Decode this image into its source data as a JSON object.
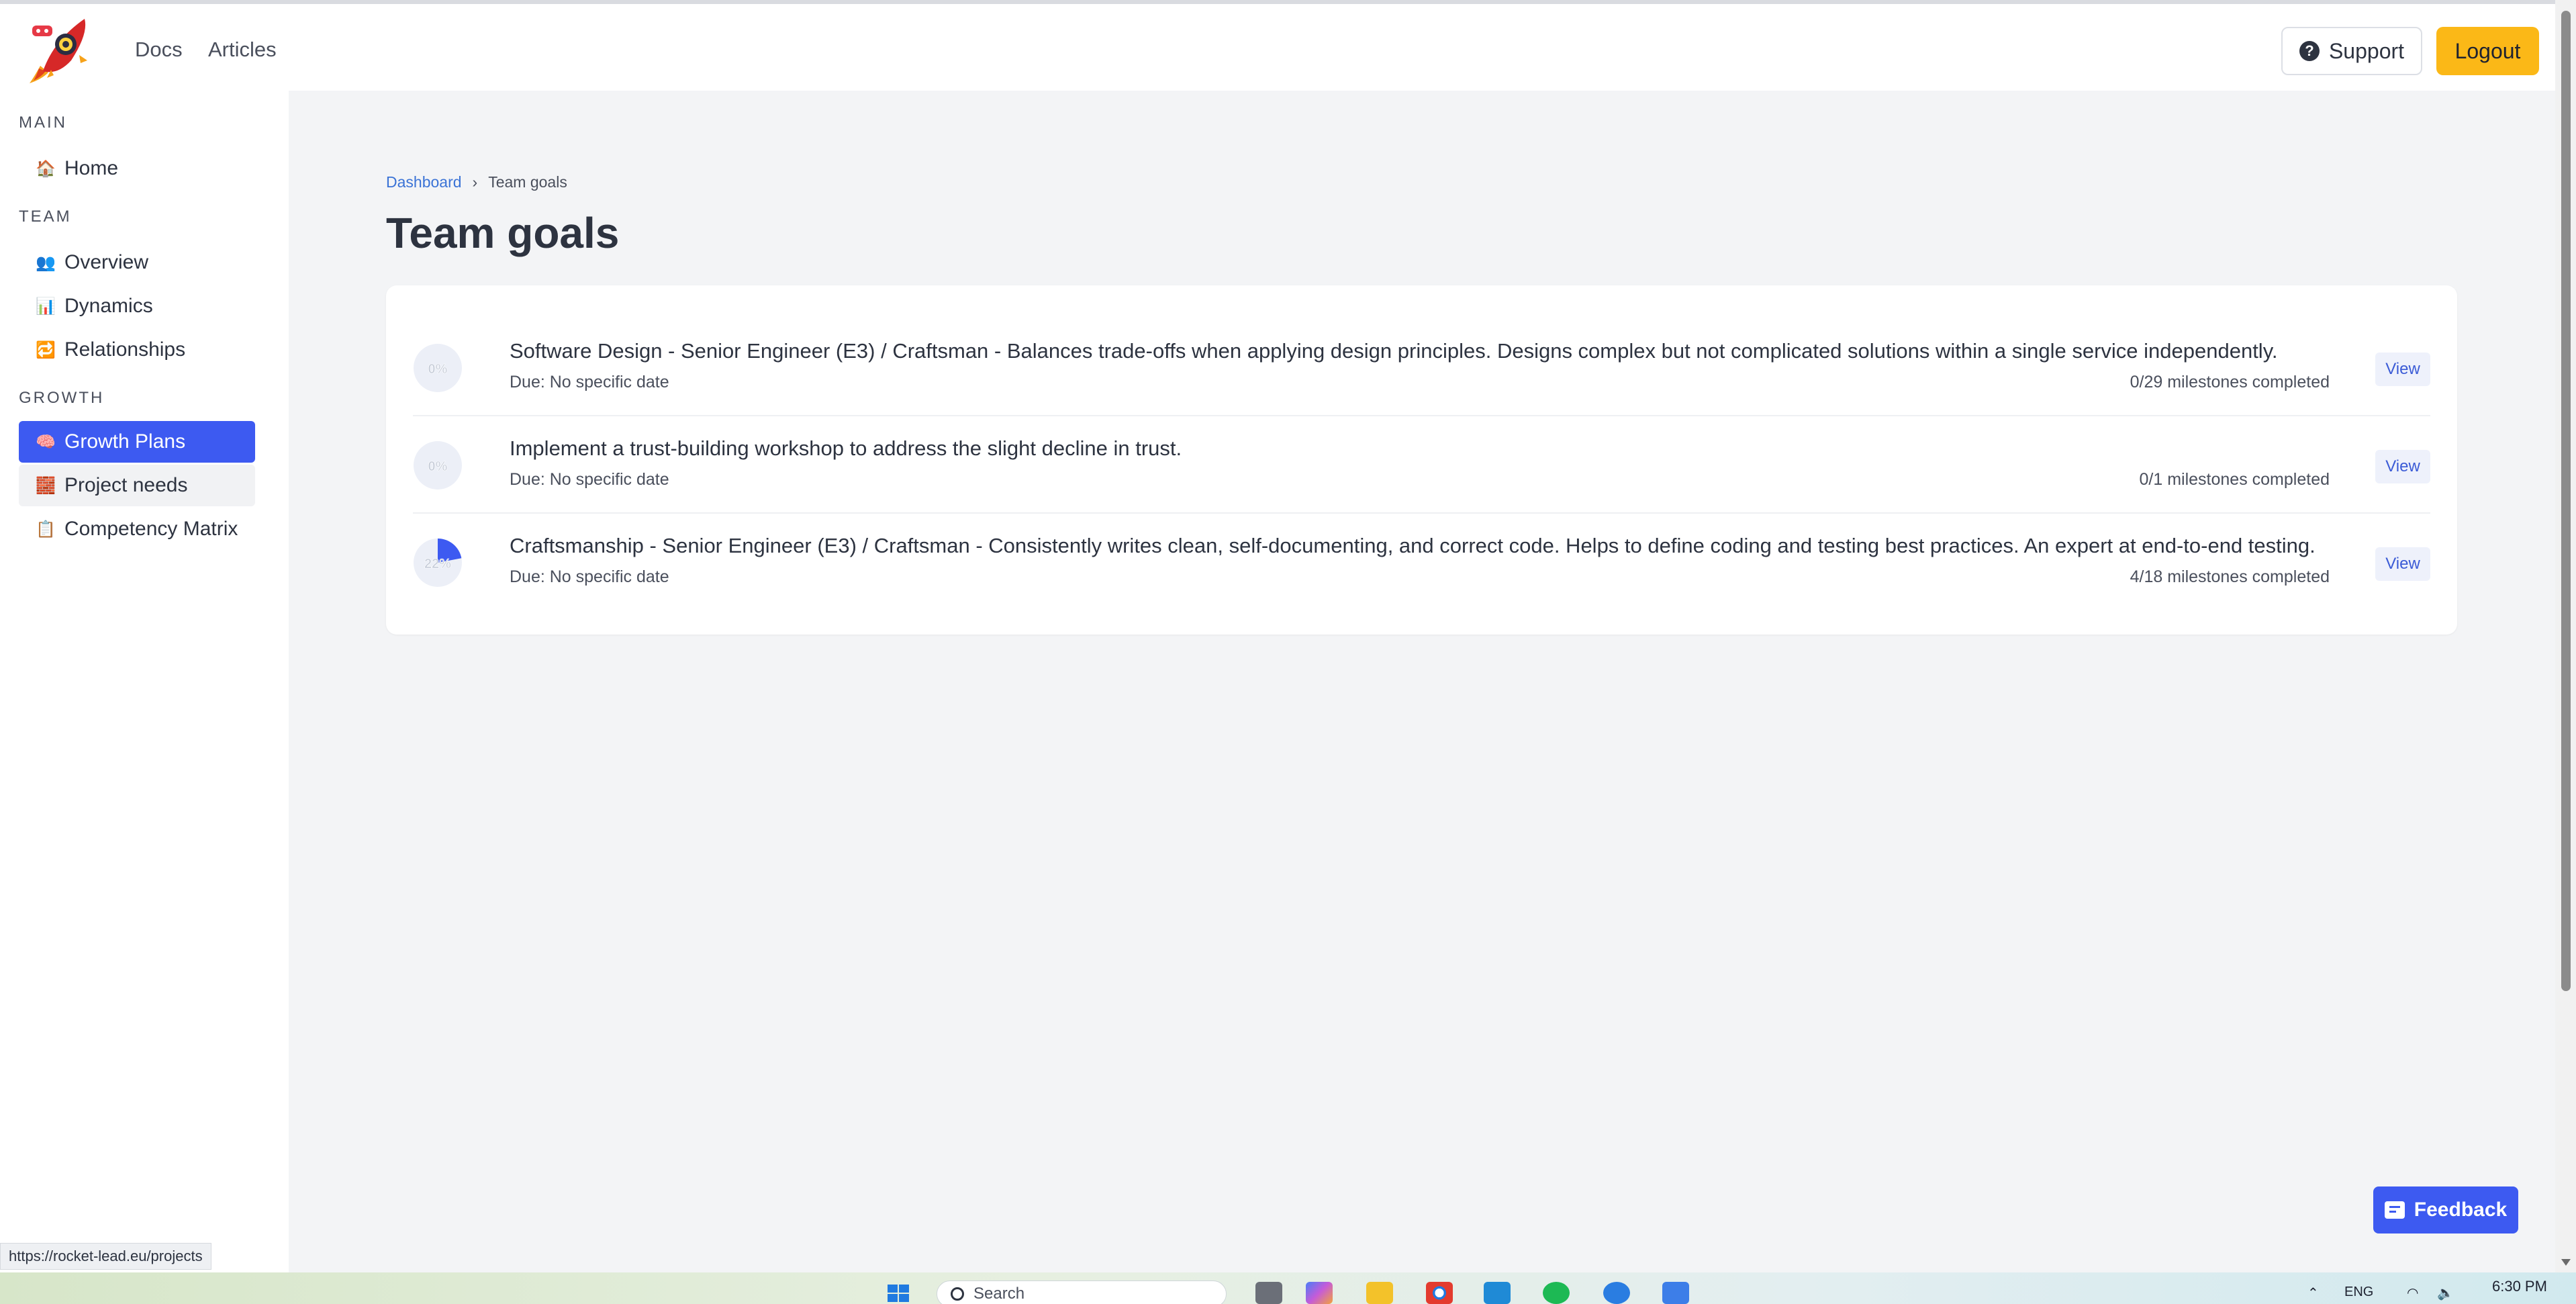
{
  "header": {
    "nav": [
      "Docs",
      "Articles"
    ],
    "support_label": "Support",
    "logout_label": "Logout"
  },
  "sidebar": {
    "sections": [
      {
        "title": "MAIN",
        "items": [
          {
            "label": "Home",
            "icon": "house-icon",
            "glyph": "🏠"
          }
        ]
      },
      {
        "title": "TEAM",
        "items": [
          {
            "label": "Overview",
            "icon": "people-icon",
            "glyph": "👥"
          },
          {
            "label": "Dynamics",
            "icon": "bar-chart-icon",
            "glyph": "📊"
          },
          {
            "label": "Relationships",
            "icon": "repeat-icon",
            "glyph": "🔁"
          }
        ]
      },
      {
        "title": "GROWTH",
        "items": [
          {
            "label": "Growth Plans",
            "icon": "brain-icon",
            "glyph": "🧠",
            "active": true
          },
          {
            "label": "Project needs",
            "icon": "bricks-icon",
            "glyph": "🧱",
            "hover": true
          },
          {
            "label": "Competency Matrix",
            "icon": "clipboard-icon",
            "glyph": "📋"
          }
        ]
      }
    ]
  },
  "breadcrumb": {
    "parent": "Dashboard",
    "separator": "›",
    "current": "Team goals"
  },
  "page_title": "Team goals",
  "goals": [
    {
      "progress_label": "0%",
      "progress": 0,
      "title": "Software Design - Senior Engineer (E3) / Craftsman - Balances trade-offs when applying design principles. Designs complex but not complicated solutions within a single service independently.",
      "due": "Due: No specific date",
      "milestones": "0/29 milestones completed",
      "view_label": "View"
    },
    {
      "progress_label": "0%",
      "progress": 0,
      "title": "Implement a trust-building workshop to address the slight decline in trust.",
      "due": "Due: No specific date",
      "milestones": "0/1 milestones completed",
      "view_label": "View"
    },
    {
      "progress_label": "22%",
      "progress": 0.22,
      "title": "Craftsmanship - Senior Engineer (E3) / Craftsman - Consistently writes clean, self-documenting, and correct code. Helps to define coding and testing best practices. An expert at end-to-end testing.",
      "due": "Due: No specific date",
      "milestones": "4/18 milestones completed",
      "view_label": "View"
    }
  ],
  "feedback_label": "Feedback",
  "status_url": "https://rocket-lead.eu/projects",
  "taskbar": {
    "search_placeholder": "Search",
    "language": "ENG",
    "time": "6:30 PM"
  },
  "colors": {
    "accent": "#3d5af1",
    "logout": "#fbb817",
    "progress_fill": "#3d5af1",
    "progress_track": "#eceff7",
    "main_bg": "#f3f4f6"
  }
}
